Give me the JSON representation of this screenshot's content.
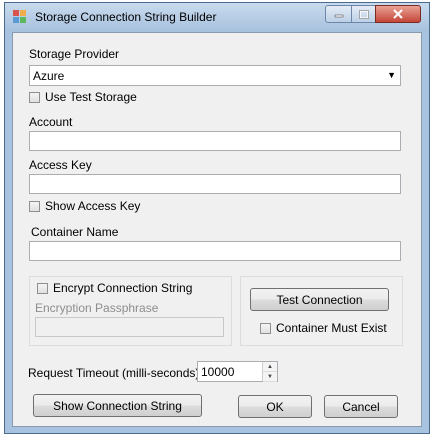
{
  "window": {
    "title": "Storage Connection String Builder"
  },
  "form": {
    "storage_provider_label": "Storage Provider",
    "storage_provider_value": "Azure",
    "use_test_storage_label": "Use Test Storage",
    "account_label": "Account",
    "account_value": "",
    "access_key_label": "Access Key",
    "access_key_value": "",
    "show_access_key_label": "Show Access Key",
    "container_name_label": "Container Name",
    "container_name_value": "",
    "encrypt_label": "Encrypt Connection String",
    "passphrase_label": "Encryption Passphrase",
    "passphrase_value": "",
    "test_connection_label": "Test Connection",
    "container_must_exist_label": "Container Must Exist",
    "timeout_label": "Request Timeout (milli-seconds)",
    "timeout_value": "10000"
  },
  "buttons": {
    "show_connection_string": "Show Connection String",
    "ok": "OK",
    "cancel": "Cancel"
  }
}
